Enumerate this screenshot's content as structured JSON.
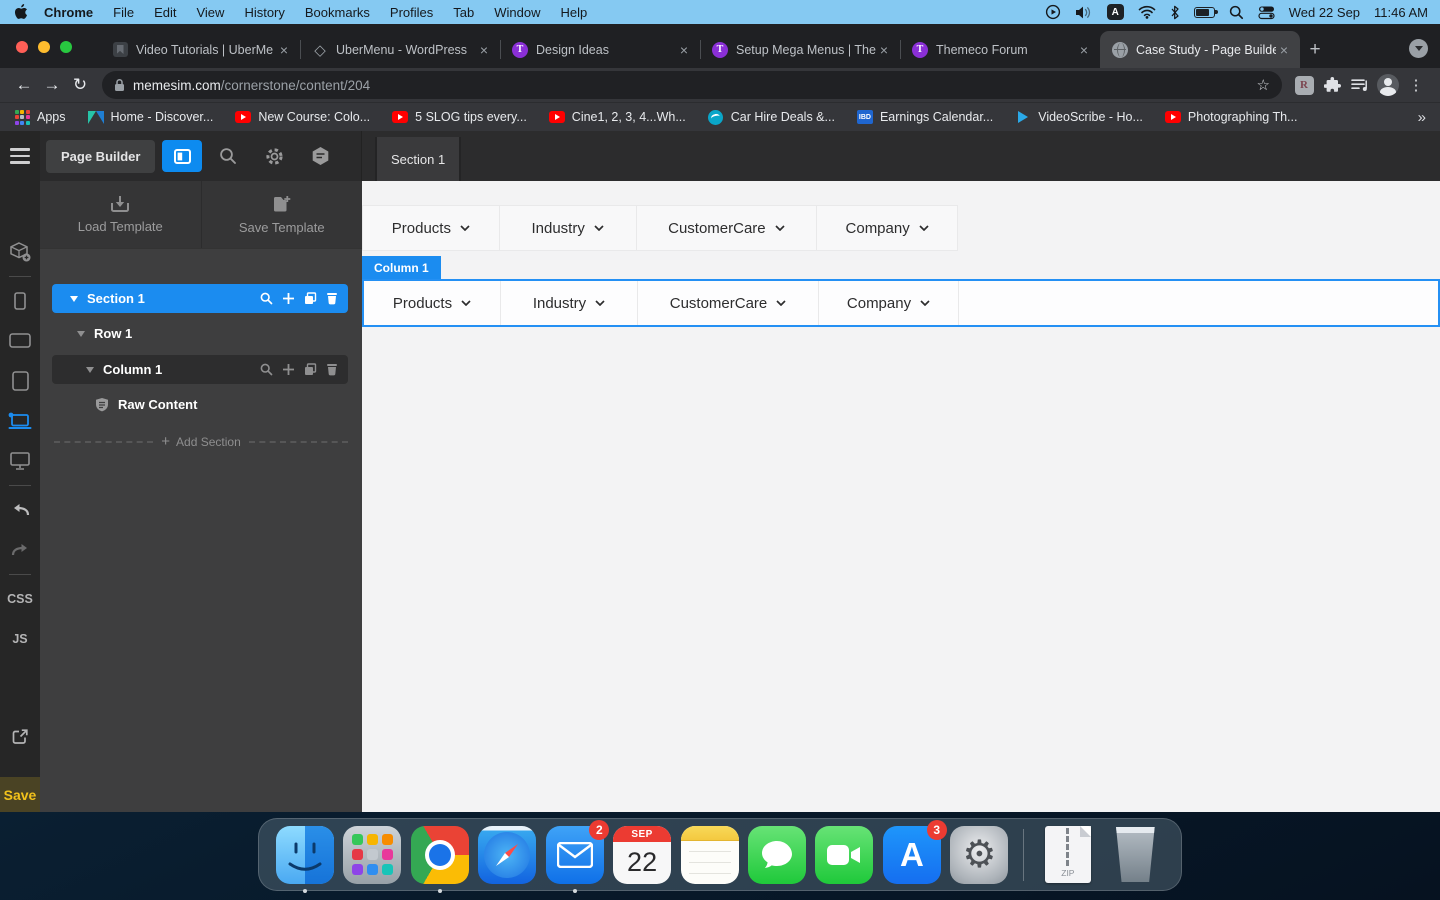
{
  "glyphs": {
    "close": "×",
    "plus": "+",
    "double_chevron": "»",
    "dots": "⋮",
    "star": "☆",
    "back": "←",
    "forward": "→",
    "reload": "↻",
    "gear": "⚙",
    "diamond": "◇"
  },
  "menubar": {
    "items": [
      "Chrome",
      "File",
      "Edit",
      "View",
      "History",
      "Bookmarks",
      "Profiles",
      "Tab",
      "Window",
      "Help"
    ],
    "input_badge": "A",
    "date": "Wed 22 Sep",
    "time": "11:46 AM"
  },
  "chrome": {
    "tabs": [
      {
        "title": "Video Tutorials | UberMe"
      },
      {
        "title": "UberMenu - WordPress"
      },
      {
        "title": "Design Ideas"
      },
      {
        "title": "Setup Mega Menus | The"
      },
      {
        "title": "Themeco Forum"
      },
      {
        "title": "Case Study - Page Builde"
      }
    ],
    "themeco_letter": "T",
    "url": {
      "host": "memesim.com",
      "path": "/cornerstone/content/204"
    },
    "extension_badge": "R",
    "bookmarks": {
      "apps_label": "Apps",
      "ibd_label": "IBD",
      "items": [
        "Home - Discover...",
        "New Course: Colo...",
        "5 SLOG tips every...",
        "Cine1, 2, 3, 4...Wh...",
        "Car Hire Deals &...",
        "Earnings Calendar...",
        "VideoScribe - Ho...",
        "Photographing Th..."
      ]
    }
  },
  "builder": {
    "title": "Page Builder",
    "content_tab": "Section 1",
    "load_template": "Load Template",
    "save_template": "Save Template",
    "tree": {
      "section": "Section 1",
      "row": "Row 1",
      "column": "Column 1",
      "element": "Raw Content",
      "add_section": "Add Section"
    },
    "strip": {
      "css": "CSS",
      "js": "JS",
      "save": "Save"
    },
    "accent": "#1b8cf0"
  },
  "page": {
    "column_label": "Column 1",
    "nav_items": [
      "Products",
      "Industry",
      "CustomerCare",
      "Company"
    ]
  },
  "dock": {
    "mail_badge": "2",
    "appstore_badge": "3",
    "appstore_letter": "A",
    "calendar": {
      "month": "SEP",
      "day": "22"
    },
    "zip_label": "ZIP"
  }
}
